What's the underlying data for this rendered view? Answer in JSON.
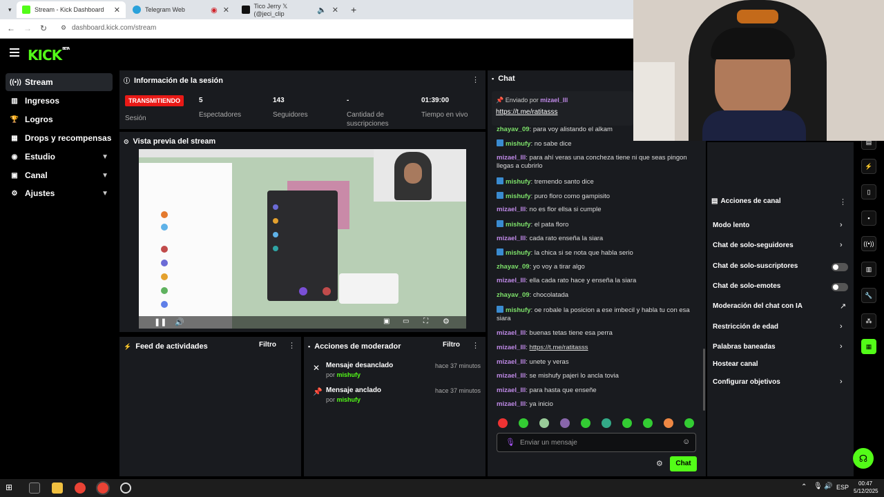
{
  "browser": {
    "tabs": [
      {
        "label": "Stream - Kick Dashboard"
      },
      {
        "label": "Telegram Web"
      },
      {
        "label": "Tico Jerry 𝕏 (@jeci_clip"
      }
    ],
    "url": "dashboard.kick.com/stream"
  },
  "logo": {
    "text": "KICK",
    "tag": "BETA"
  },
  "sidebar": {
    "items": [
      {
        "label": "Stream"
      },
      {
        "label": "Ingresos"
      },
      {
        "label": "Logros"
      },
      {
        "label": "Drops y recompensas"
      },
      {
        "label": "Estudio"
      },
      {
        "label": "Canal"
      },
      {
        "label": "Ajustes"
      }
    ]
  },
  "session": {
    "title": "Información de la sesión",
    "status_badge": "TRANSMITIENDO",
    "status_label": "Sesión",
    "viewers_value": "5",
    "viewers_label": "Espectadores",
    "followers_value": "143",
    "followers_label": "Seguidores",
    "subs_value": "-",
    "subs_label": "Cantidad de suscripciones",
    "uptime_value": "01:39:00",
    "uptime_label": "Tiempo en vivo"
  },
  "preview": {
    "title": "Vista previa del stream"
  },
  "activity": {
    "title": "Feed de actividades",
    "filter": "Filtro"
  },
  "modactions": {
    "title": "Acciones de moderador",
    "filter": "Filtro",
    "items": [
      {
        "title": "Mensaje desanclado",
        "by": "por",
        "user": "mishufy",
        "time": "hace 37 minutos"
      },
      {
        "title": "Mensaje anclado",
        "by": "por",
        "user": "mishufy",
        "time": "hace 37 minutos"
      }
    ]
  },
  "chat": {
    "title": "Chat",
    "pinned": {
      "label": "Enviado por",
      "user": "mizael_lll",
      "link": "https://t.me/ratitasss"
    },
    "messages": [
      {
        "user": "zhayav_09",
        "text": "para voy alistando el alkam",
        "color": "#7de06a",
        "badge": false
      },
      {
        "user": "mishufy",
        "text": "no sabe dice",
        "color": "#7de06a",
        "badge": true
      },
      {
        "user": "mizael_lll",
        "text": "para ahí veras una concheza tiene ni que seas pingon llegas a cubrirlo",
        "color": "#c08ae8",
        "badge": false
      },
      {
        "user": "mishufy",
        "text": "tremendo santo dice",
        "color": "#7de06a",
        "badge": true
      },
      {
        "user": "mishufy",
        "text": "puro floro como gampisito",
        "color": "#7de06a",
        "badge": true
      },
      {
        "user": "mizael_lll",
        "text": "no es flor ellsa si cumple",
        "color": "#c08ae8",
        "badge": false
      },
      {
        "user": "mishufy",
        "text": "el pata floro",
        "color": "#7de06a",
        "badge": true
      },
      {
        "user": "mizael_lll",
        "text": "cada rato enseña la siara",
        "color": "#c08ae8",
        "badge": false
      },
      {
        "user": "mishufy",
        "text": "la chica si se nota que habla serio",
        "color": "#7de06a",
        "badge": true
      },
      {
        "user": "zhayav_09",
        "text": "yo voy a tirar algo",
        "color": "#7de06a",
        "badge": false
      },
      {
        "user": "mizael_lll",
        "text": "ella cada rato hace y enseña la siara",
        "color": "#c08ae8",
        "badge": false
      },
      {
        "user": "zhayav_09",
        "text": "chocolatada",
        "color": "#7de06a",
        "badge": false
      },
      {
        "user": "mishufy",
        "text": "oe robale la posicion a ese imbecil y habla tu con esa siara",
        "color": "#7de06a",
        "badge": true
      },
      {
        "user": "mizael_lll",
        "text": "buenas tetas tiene esa perra",
        "color": "#c08ae8",
        "badge": false
      },
      {
        "user": "mizael_lll",
        "text": "https://t.me/ratitasss",
        "color": "#c08ae8",
        "badge": false
      },
      {
        "user": "mizael_lll",
        "text": "unete y veras",
        "color": "#c08ae8",
        "badge": false
      },
      {
        "user": "mizael_lll",
        "text": "se mishufy pajeri lo ancla tovia",
        "color": "#c08ae8",
        "badge": false
      },
      {
        "user": "mizael_lll",
        "text": "para hasta que enseñe",
        "color": "#c08ae8",
        "badge": false
      },
      {
        "user": "mizael_lll",
        "text": "ya inicio",
        "color": "#c08ae8",
        "badge": false
      }
    ],
    "input_placeholder": "Enviar un mensaje",
    "send_label": "Chat"
  },
  "channel_actions": {
    "title": "Acciones de canal",
    "items": [
      {
        "label": "Modo lento",
        "control": "chevron"
      },
      {
        "label": "Chat de solo-seguidores",
        "control": "chevron"
      },
      {
        "label": "Chat de solo-suscriptores",
        "control": "toggle-off"
      },
      {
        "label": "Chat de solo-emotes",
        "control": "toggle-off"
      },
      {
        "label": "Moderación del chat con IA",
        "control": "external"
      },
      {
        "label": "Restricción de edad",
        "control": "chevron"
      },
      {
        "label": "Palabras baneadas",
        "control": "chevron"
      },
      {
        "label": "Hostear canal",
        "control": "none"
      },
      {
        "label": "Configurar objetivos",
        "control": "chevron"
      }
    ]
  },
  "taskbar": {
    "lang": "ESP",
    "time": "00:47",
    "date": "5/12/2025"
  },
  "colors": {
    "brand": "#53fc18",
    "live": "#e91916",
    "panel": "#191b1f"
  }
}
